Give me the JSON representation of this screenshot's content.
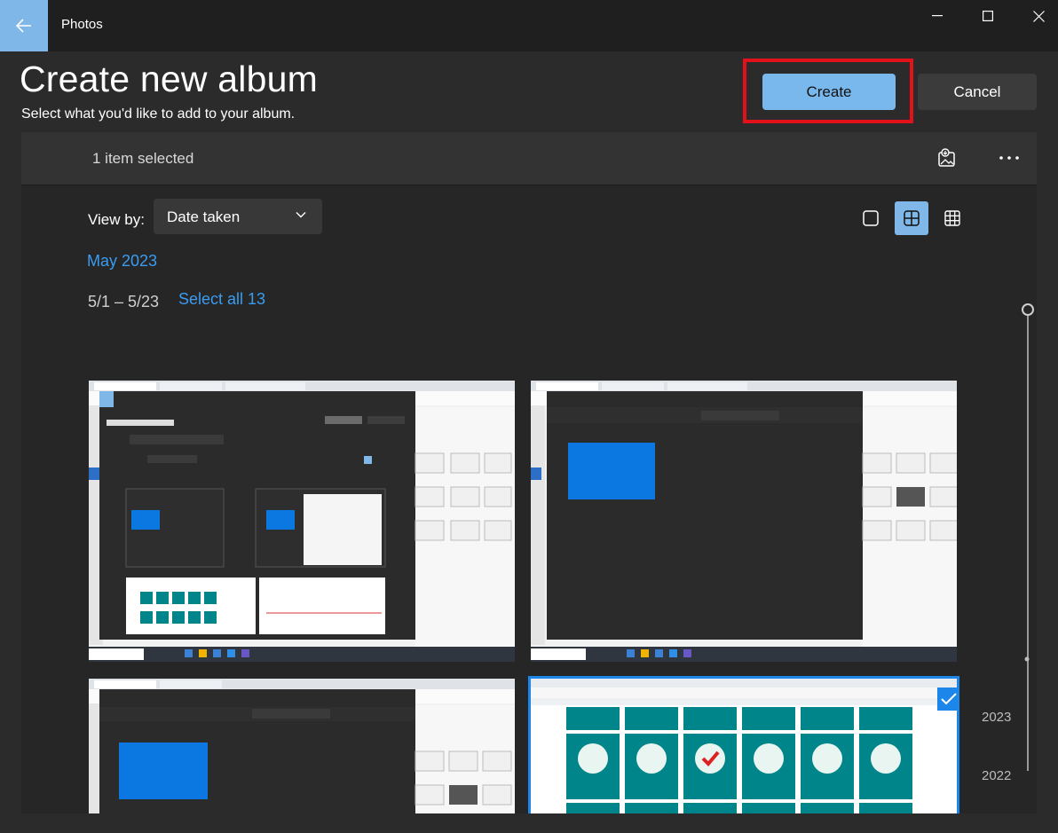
{
  "window": {
    "title": "Photos"
  },
  "header": {
    "title": "Create new album",
    "subtitle": "Select what you'd like to add to your album.",
    "create_label": "Create",
    "cancel_label": "Cancel"
  },
  "commandbar": {
    "selection_text": "1 item selected"
  },
  "view": {
    "label": "View by:",
    "selected_option": "Date taken",
    "thumbnail_size": "medium"
  },
  "gallery": {
    "month": "May 2023",
    "date_range": "5/1 – 5/23",
    "select_all_label": "Select all 13",
    "thumbnails": [
      {
        "name": "Screenshot of Photos app - Create new album",
        "selected": false
      },
      {
        "name": "Screenshot of Photos app - Albums",
        "selected": false
      },
      {
        "name": "Screenshot of Photos app - Albums (second)",
        "selected": false
      },
      {
        "name": "Screenshot of BrainPOP Social Studies - Government",
        "selected": true
      }
    ]
  },
  "timeline": {
    "years": [
      "2023",
      "2022"
    ]
  },
  "colors": {
    "accent": "#79b8ec",
    "link": "#3a9cf0",
    "highlight": "#e3121a"
  }
}
